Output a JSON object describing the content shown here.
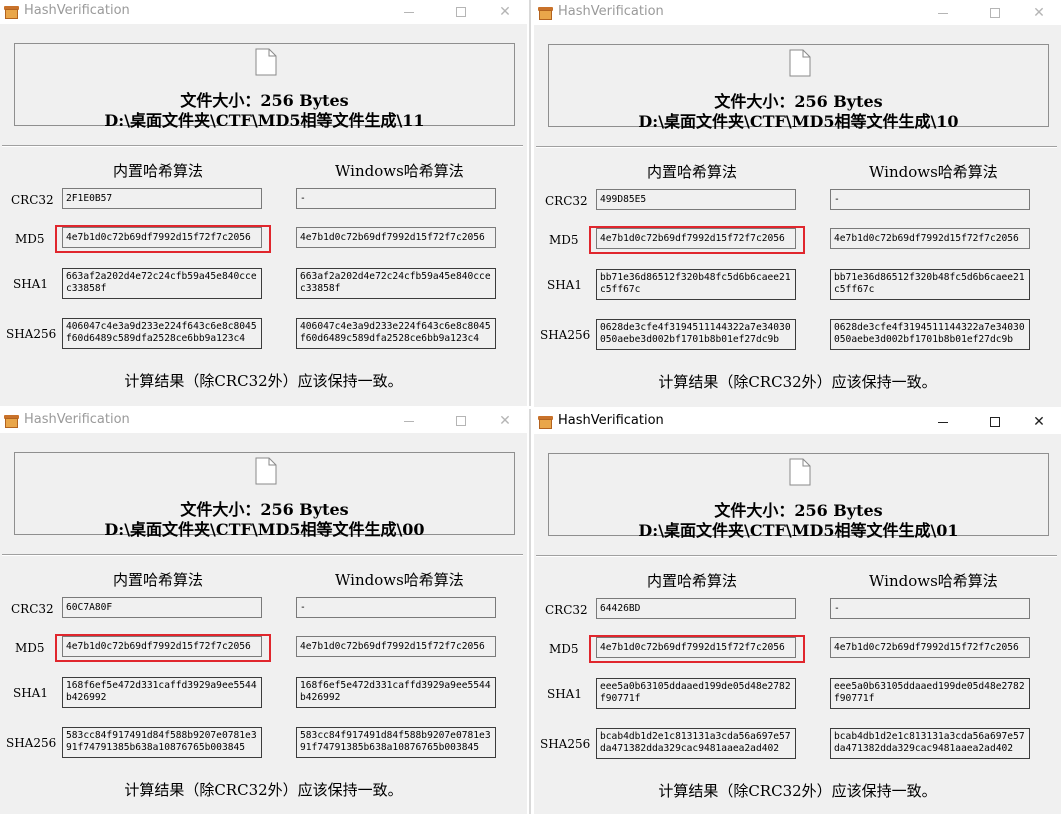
{
  "windows": [
    {
      "title": "HashVerification",
      "active": false,
      "file_size": "文件大小：256 Bytes",
      "file_path": "D:\\桌面文件夹\\CTF\\MD5相等文件生成\\11",
      "builtin_header": "内置哈希算法",
      "windows_header": "Windows哈希算法",
      "labels": {
        "crc32": "CRC32",
        "md5": "MD5",
        "sha1": "SHA1",
        "sha256": "SHA256"
      },
      "builtin": {
        "crc32": "2F1E0B57",
        "md5": "4e7b1d0c72b69df7992d15f72f7c2056",
        "sha1": "663af2a202d4e72c24cfb59a45e840ccec33858f",
        "sha256": "406047c4e3a9d233e224f643c6e8c8045f60d6489c589dfa2528ce6bb9a123c4"
      },
      "windows_hash": {
        "crc32": "-",
        "md5": "4e7b1d0c72b69df7992d15f72f7c2056",
        "sha1": "663af2a202d4e72c24cfb59a45e840ccec33858f",
        "sha256": "406047c4e3a9d233e224f643c6e8c8045f60d6489c589dfa2528ce6bb9a123c4"
      },
      "footer": "计算结果（除CRC32外）应该保持一致。"
    },
    {
      "title": "HashVerification",
      "active": false,
      "file_size": "文件大小：256 Bytes",
      "file_path": "D:\\桌面文件夹\\CTF\\MD5相等文件生成\\10",
      "builtin_header": "内置哈希算法",
      "windows_header": "Windows哈希算法",
      "labels": {
        "crc32": "CRC32",
        "md5": "MD5",
        "sha1": "SHA1",
        "sha256": "SHA256"
      },
      "builtin": {
        "crc32": "499D85E5",
        "md5": "4e7b1d0c72b69df7992d15f72f7c2056",
        "sha1": "bb71e36d86512f320b48fc5d6b6caee21c5ff67c",
        "sha256": "0628de3cfe4f3194511144322a7e34030050aebe3d002bf1701b8b01ef27dc9b"
      },
      "windows_hash": {
        "crc32": "-",
        "md5": "4e7b1d0c72b69df7992d15f72f7c2056",
        "sha1": "bb71e36d86512f320b48fc5d6b6caee21c5ff67c",
        "sha256": "0628de3cfe4f3194511144322a7e34030050aebe3d002bf1701b8b01ef27dc9b"
      },
      "footer": "计算结果（除CRC32外）应该保持一致。"
    },
    {
      "title": "HashVerification",
      "active": false,
      "file_size": "文件大小：256 Bytes",
      "file_path": "D:\\桌面文件夹\\CTF\\MD5相等文件生成\\00",
      "builtin_header": "内置哈希算法",
      "windows_header": "Windows哈希算法",
      "labels": {
        "crc32": "CRC32",
        "md5": "MD5",
        "sha1": "SHA1",
        "sha256": "SHA256"
      },
      "builtin": {
        "crc32": "60C7A80F",
        "md5": "4e7b1d0c72b69df7992d15f72f7c2056",
        "sha1": "168f6ef5e472d331caffd3929a9ee5544b426992",
        "sha256": "583cc84f917491d84f588b9207e0781e391f74791385b638a10876765b003845"
      },
      "windows_hash": {
        "crc32": "-",
        "md5": "4e7b1d0c72b69df7992d15f72f7c2056",
        "sha1": "168f6ef5e472d331caffd3929a9ee5544b426992",
        "sha256": "583cc84f917491d84f588b9207e0781e391f74791385b638a10876765b003845"
      },
      "footer": "计算结果（除CRC32外）应该保持一致。"
    },
    {
      "title": "HashVerification",
      "active": true,
      "file_size": "文件大小：256 Bytes",
      "file_path": "D:\\桌面文件夹\\CTF\\MD5相等文件生成\\01",
      "builtin_header": "内置哈希算法",
      "windows_header": "Windows哈希算法",
      "labels": {
        "crc32": "CRC32",
        "md5": "MD5",
        "sha1": "SHA1",
        "sha256": "SHA256"
      },
      "builtin": {
        "crc32": "64426BD",
        "md5": "4e7b1d0c72b69df7992d15f72f7c2056",
        "sha1": "eee5a0b63105ddaaed199de05d48e2782f90771f",
        "sha256": "bcab4db1d2e1c813131a3cda56a697e57da471382dda329cac9481aaea2ad402"
      },
      "windows_hash": {
        "crc32": "-",
        "md5": "4e7b1d0c72b69df7992d15f72f7c2056",
        "sha1": "eee5a0b63105ddaaed199de05d48e2782f90771f",
        "sha256": "bcab4db1d2e1c813131a3cda56a697e57da471382dda329cac9481aaea2ad402"
      },
      "footer": "计算结果（除CRC32外）应该保持一致。"
    }
  ],
  "colors": {
    "highlight": "#e0262d",
    "window_bg": "#f0f0f0",
    "titlebar_bg": "#ffffff"
  },
  "icons": {
    "app": "app-window-icon",
    "file": "file-icon",
    "minimize": "minimize-icon",
    "maximize": "maximize-icon",
    "close": "close-icon"
  }
}
